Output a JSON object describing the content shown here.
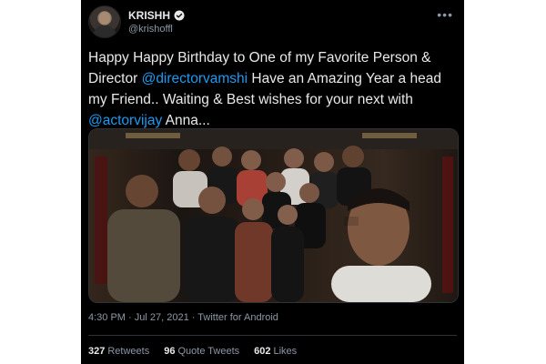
{
  "tweet": {
    "author": {
      "name": "KRISHH",
      "handle": "@krishoffl"
    },
    "more_icon": "more-horizontal-icon",
    "verified_icon": "verified-badge-icon",
    "text": {
      "part1": "Happy Happy Birthday to One of my Favorite Person & Director ",
      "mention1": "@directorvamshi",
      "part2": " Have an Amazing Year a head my Friend.. Waiting & Best wishes for your next with ",
      "mention2": "@actorvijay",
      "part3": " Anna..."
    },
    "meta": {
      "time": "4:30 PM",
      "separator1": " · ",
      "date": "Jul 27, 2021",
      "separator2": " · ",
      "client": "Twitter for Android"
    },
    "stats": {
      "retweets_count": "327",
      "retweets_label": "Retweets",
      "quotes_count": "96",
      "quotes_label": "Quote Tweets",
      "likes_count": "602",
      "likes_label": "Likes"
    },
    "colors": {
      "background": "#000000",
      "text": "#e7e9ea",
      "muted": "#8b98a5",
      "link": "#1d9bf0"
    }
  }
}
